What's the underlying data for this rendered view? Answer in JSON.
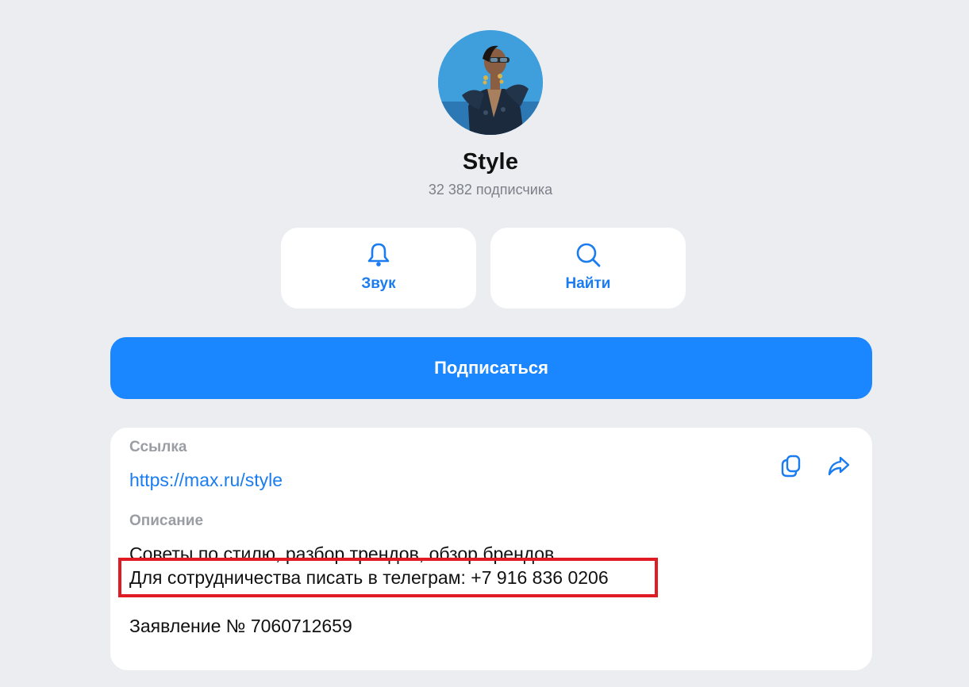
{
  "channel": {
    "name": "Style",
    "subscribers": "32 382 подписчика"
  },
  "actions": {
    "sound_label": "Звук",
    "search_label": "Найти"
  },
  "subscribe": {
    "label": "Подписаться"
  },
  "info": {
    "link_label": "Ссылка",
    "link_value": "https://max.ru/style",
    "description_label": "Описание",
    "description_lines": [
      "Советы по стилю, разбор трендов, обзор брендов",
      "Для сотрудничества писать в телеграм: +7 916 836 0206",
      "Заявление № 7060712659"
    ]
  },
  "colors": {
    "accent": "#1a86ff",
    "link": "#1a7cf0",
    "background": "#ecedf1",
    "card": "#ffffff",
    "highlight": "#e01b24"
  },
  "icons": {
    "sound": "bell-icon",
    "search": "search-icon",
    "copy": "copy-icon",
    "share": "share-icon"
  }
}
